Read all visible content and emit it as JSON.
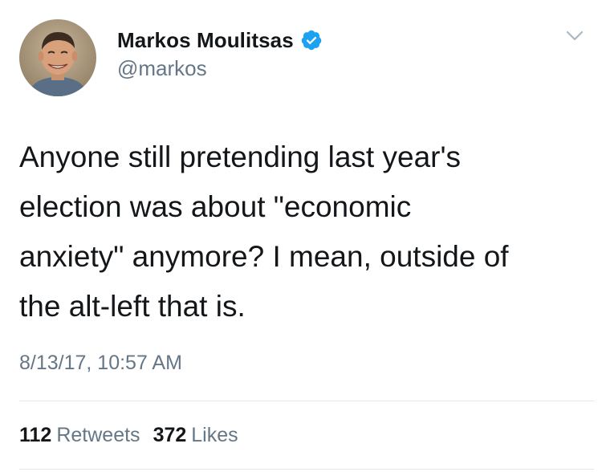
{
  "author": {
    "display_name": "Markos Moulitsas",
    "handle": "@markos",
    "verified": true,
    "avatar_icon": "profile-photo-avatar"
  },
  "tweet": {
    "text": "Anyone still pretending last year's\nelection was about \"economic\nanxiety\" anymore? I mean, outside of\nthe alt-left that is.",
    "timestamp": "8/13/17, 10:57 AM"
  },
  "stats": {
    "retweets_count": "112",
    "retweets_label": "Retweets",
    "likes_count": "372",
    "likes_label": "Likes"
  },
  "colors": {
    "text_primary": "#14171a",
    "text_secondary": "#657786",
    "verified_blue": "#1da1f2",
    "divider": "#e1e8ed"
  },
  "icons": {
    "menu": "chevron-down-icon",
    "verified": "verified-badge-icon"
  }
}
